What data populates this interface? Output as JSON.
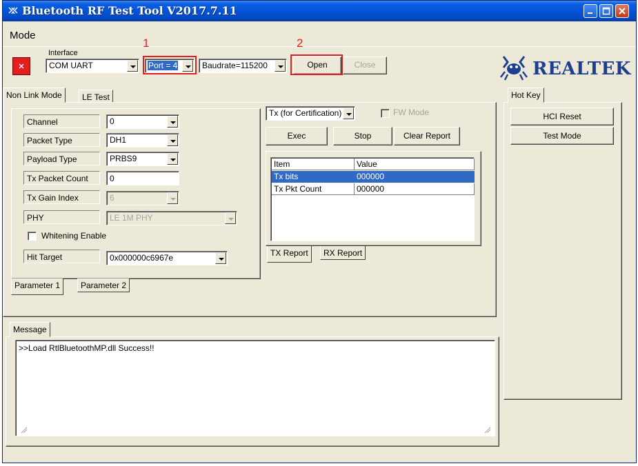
{
  "window": {
    "title": "Bluetooth RF Test Tool V2017.7.11"
  },
  "menu": {
    "mode": "Mode"
  },
  "interface": {
    "group_title": "Interface",
    "type_value": "COM UART",
    "port_value": "Port = 4",
    "baud_value": "Baudrate=115200",
    "open_label": "Open",
    "close_label": "Close"
  },
  "annotations": {
    "num1": "1",
    "num2": "2",
    "color": "#e31e1e"
  },
  "logo": {
    "text": "REALTEK"
  },
  "tabs": {
    "non_link_mode": "Non Link Mode",
    "le_test": "LE Test",
    "hot_key": "Hot Key",
    "message": "Message"
  },
  "params": {
    "channel_label": "Channel",
    "channel_value": "0",
    "packet_type_label": "Packet Type",
    "packet_type_value": "DH1",
    "payload_type_label": "Payload Type",
    "payload_type_value": "PRBS9",
    "tx_packet_count_label": "Tx Packet Count",
    "tx_packet_count_value": "0",
    "tx_gain_index_label": "Tx Gain Index",
    "tx_gain_index_value": "6",
    "phy_label": "PHY",
    "phy_value": "LE 1M PHY",
    "whitening_label": "Whitening Enable",
    "hit_target_label": "Hit Target",
    "hit_target_value": "0x000000c6967e",
    "tab_param1": "Parameter 1",
    "tab_param2": "Parameter 2"
  },
  "tx": {
    "mode_value": "Tx (for Certification)",
    "fw_mode_label": "FW Mode",
    "exec_label": "Exec",
    "stop_label": "Stop",
    "clear_report_label": "Clear Report",
    "table": {
      "headers": [
        "Item",
        "Value"
      ],
      "rows": [
        [
          "Tx bits",
          "000000"
        ],
        [
          "Tx Pkt Count",
          "000000"
        ]
      ]
    },
    "tab_tx_report": "TX Report",
    "tab_rx_report": "RX Report"
  },
  "hotkeys": {
    "hci_reset": "HCI Reset",
    "test_mode": "Test Mode"
  },
  "messages": {
    "log": ">>Load RtlBluetoothMP.dll Success!!"
  },
  "colors": {
    "selection": "#316ac5",
    "stop_indicator": "#e31e1e",
    "logo": "#1c3f8f"
  }
}
